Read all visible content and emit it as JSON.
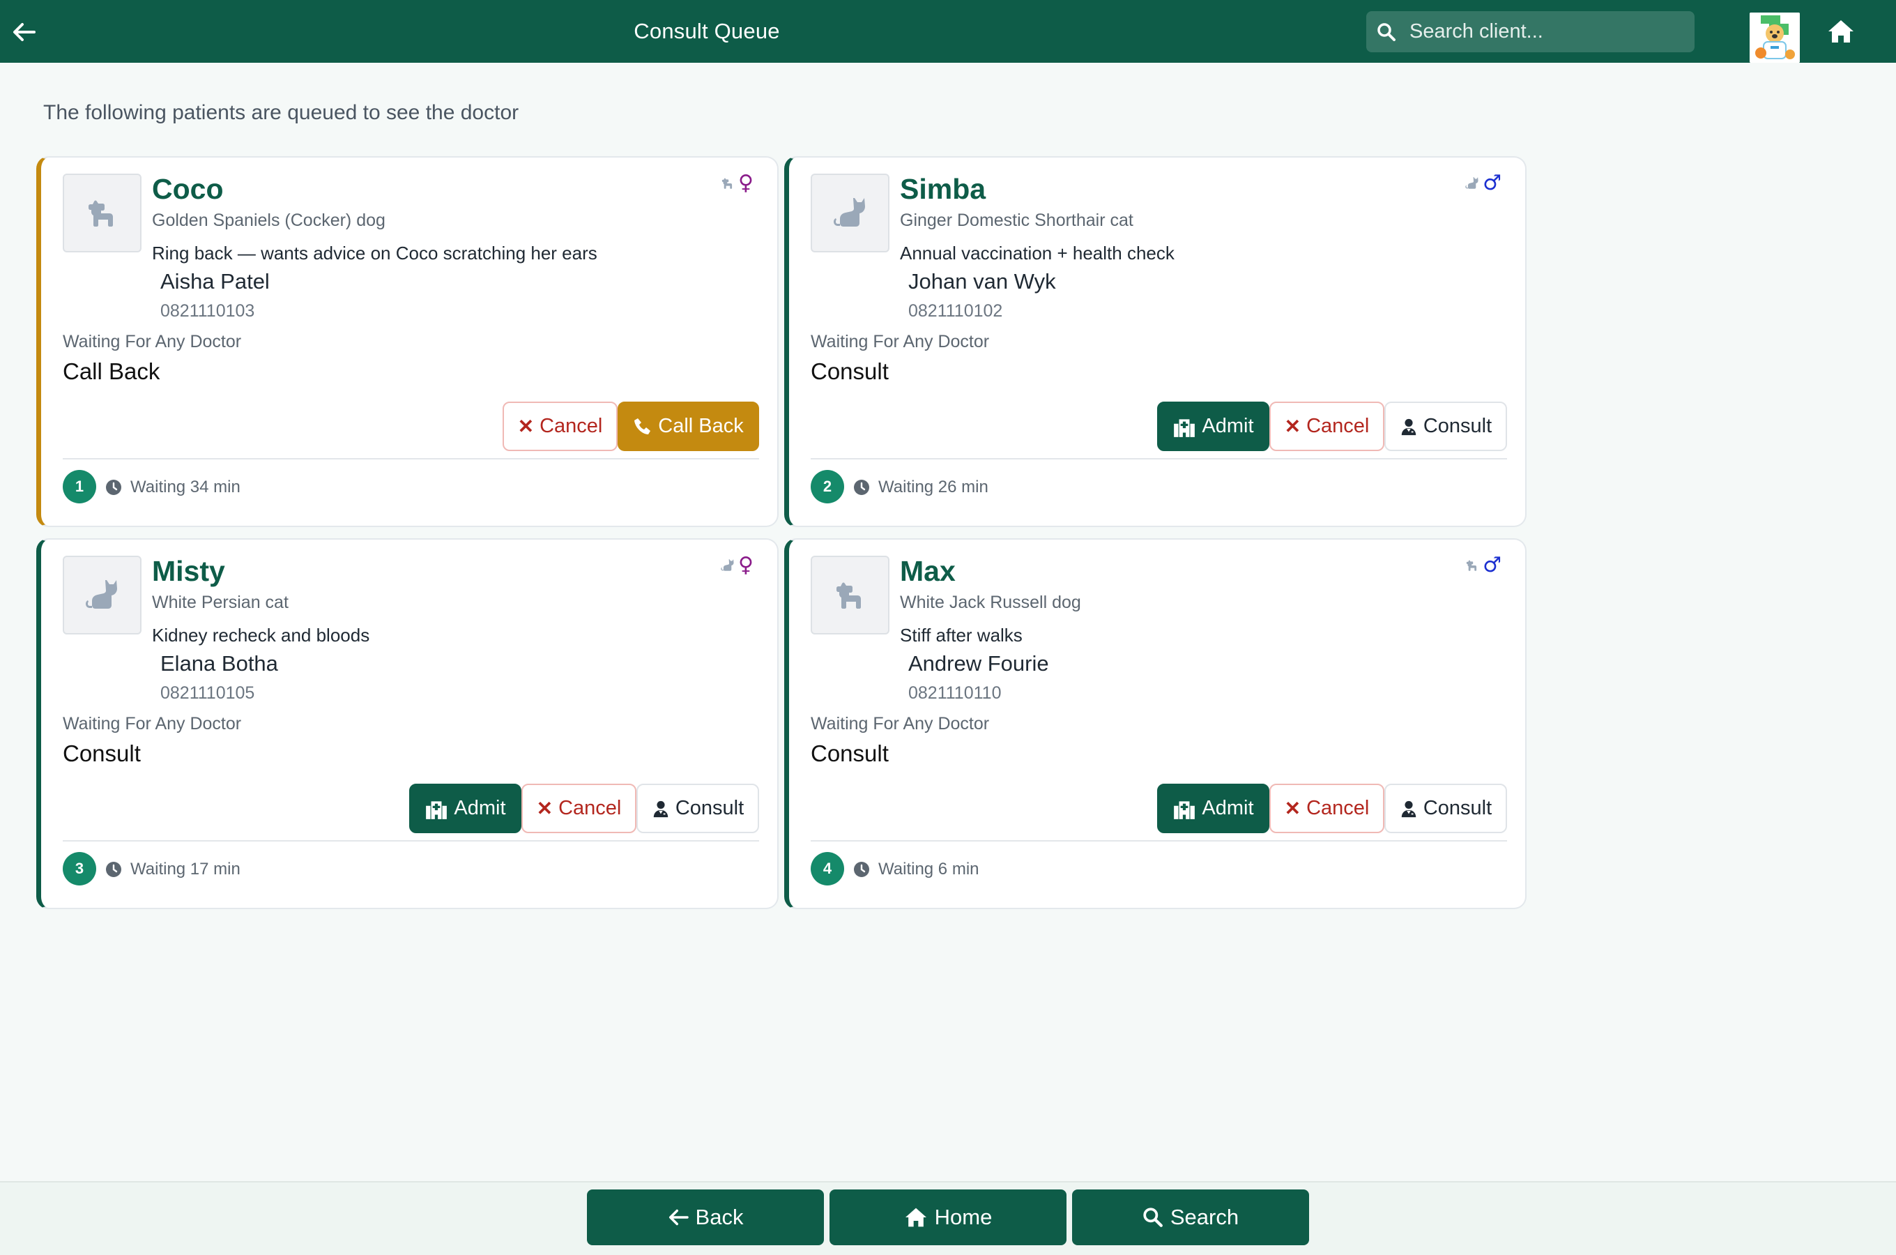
{
  "header": {
    "title": "Consult Queue",
    "search_placeholder": "Search client..."
  },
  "intro": "The following patients are queued to see the doctor",
  "colors": {
    "primary": "#0e5c48",
    "callback": "#c48a10",
    "cancel": "#b3261e",
    "badge": "#158a6a",
    "female": "#8a1b8a",
    "male": "#1b2fd0"
  },
  "queue": [
    {
      "number": "1",
      "name": "Coco",
      "species": "dog",
      "sex": "female",
      "breed": "Golden Spaniels (Cocker) dog",
      "reason": "Ring back — wants advice on Coco scratching her ears",
      "owner": "Aisha Patel",
      "phone": "0821110103",
      "waiting_for": "Waiting For Any Doctor",
      "type": "Call Back",
      "waiting": "Waiting 34 min",
      "buttons": {
        "cancel": "Cancel",
        "call_back": "Call Back"
      }
    },
    {
      "number": "2",
      "name": "Simba",
      "species": "cat",
      "sex": "male",
      "breed": "Ginger Domestic Shorthair cat",
      "reason": "Annual vaccination + health check",
      "owner": "Johan van Wyk",
      "phone": "0821110102",
      "waiting_for": "Waiting For Any Doctor",
      "type": "Consult",
      "waiting": "Waiting 26 min",
      "buttons": {
        "admit": "Admit",
        "cancel": "Cancel",
        "consult": "Consult"
      }
    },
    {
      "number": "3",
      "name": "Misty",
      "species": "cat",
      "sex": "female",
      "breed": "White Persian cat",
      "reason": "Kidney recheck and bloods",
      "owner": "Elana Botha",
      "phone": "0821110105",
      "waiting_for": "Waiting For Any Doctor",
      "type": "Consult",
      "waiting": "Waiting 17 min",
      "buttons": {
        "admit": "Admit",
        "cancel": "Cancel",
        "consult": "Consult"
      }
    },
    {
      "number": "4",
      "name": "Max",
      "species": "dog",
      "sex": "male",
      "breed": "White Jack Russell dog",
      "reason": "Stiff after walks",
      "owner": "Andrew Fourie",
      "phone": "0821110110",
      "waiting_for": "Waiting For Any Doctor",
      "type": "Consult",
      "waiting": "Waiting 6 min",
      "buttons": {
        "admit": "Admit",
        "cancel": "Cancel",
        "consult": "Consult"
      }
    }
  ],
  "footer": {
    "back": "Back",
    "home": "Home",
    "search": "Search"
  }
}
